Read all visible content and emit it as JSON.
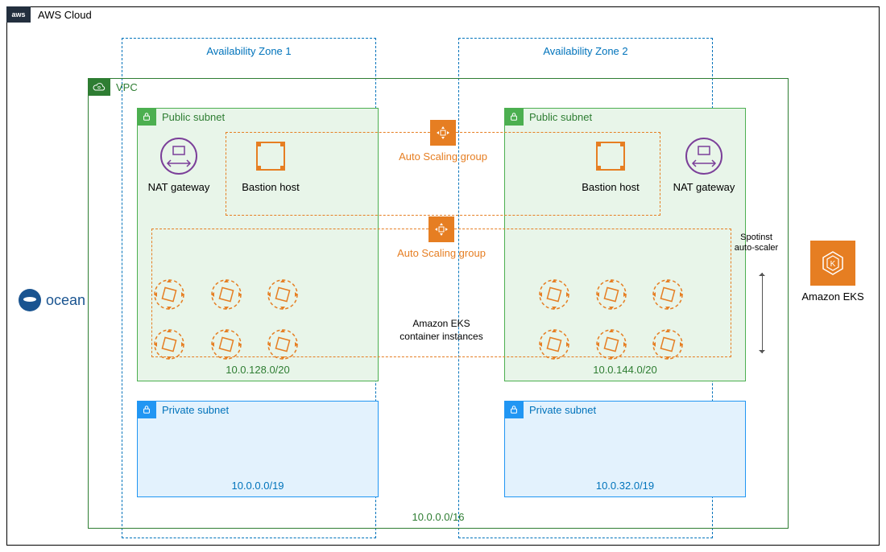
{
  "cloud": {
    "badge": "aws",
    "label": "AWS Cloud"
  },
  "az": {
    "zone1": "Availability Zone 1",
    "zone2": "Availability Zone 2"
  },
  "vpc": {
    "label": "VPC",
    "cidr": "10.0.0.0/16"
  },
  "public_subnet": {
    "label": "Public subnet",
    "ps1_cidr": "10.0.128.0/20",
    "ps2_cidr": "10.0.144.0/20"
  },
  "private_subnet": {
    "label": "Private subnet",
    "pr1_cidr": "10.0.0.0/19",
    "pr2_cidr": "10.0.32.0/19"
  },
  "nat": {
    "label": "NAT gateway"
  },
  "bastion": {
    "label": "Bastion host"
  },
  "asg": {
    "label": "Auto Scaling group"
  },
  "eks_instances": {
    "label": "Amazon EKS\ncontainer instances"
  },
  "ocean": {
    "label": "ocean"
  },
  "eks": {
    "label": "Amazon EKS"
  },
  "spotinst": {
    "label": "Spotinst auto-scaler"
  },
  "colors": {
    "aws_dark": "#232f3e",
    "green": "#2e7d32",
    "orange": "#e67e22",
    "blue": "#0073bb",
    "purple": "#7b3f99"
  }
}
